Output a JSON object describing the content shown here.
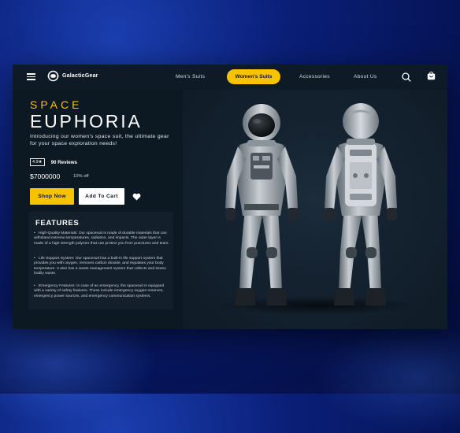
{
  "brand": {
    "name": "GalacticGear"
  },
  "nav": {
    "links": [
      "Men's Suits",
      "Women's Suits",
      "Accessories",
      "About Us"
    ],
    "active": "Women's Suits"
  },
  "hero": {
    "eyebrow": "SPACE",
    "title": "EUPHORIA",
    "description": "Introducing our women's space suit, the ultimate gear for your space exploration needs!",
    "rating": "4.9★",
    "reviews": "90 Reviews",
    "price": "$7000000",
    "discount": "10% off",
    "shop_label": "Shop Now",
    "cart_label": "Add To Cart"
  },
  "features": {
    "heading": "FEATURES",
    "items": [
      "High-Quality Materials: Our spacesuit is made of durable materials that can withstand extreme temperatures, radiation, and impacts. The outer layer is made of a high-strength polymer that can protect you from punctures and tears.",
      "Life Support System: Our spacesuit has a built-in life support system that provides you with oxygen, removes carbon dioxide, and regulates your body temperature. It also has a waste management system that collects and stores bodily waste.",
      "Emergency Features: In case of an emergency, the spacesuit is equipped with a variety of safety features. These include emergency oxygen reserves, emergency power sources, and emergency communication systems."
    ]
  },
  "icons": {
    "menu": "hamburger-icon",
    "logo": "astronaut-helmet-icon",
    "search": "search-icon",
    "cart": "shopping-bag-icon",
    "wishlist": "heart-icon"
  },
  "colors": {
    "accent": "#f7c300",
    "panel": "#0c1822",
    "background": "#0a1f78"
  }
}
